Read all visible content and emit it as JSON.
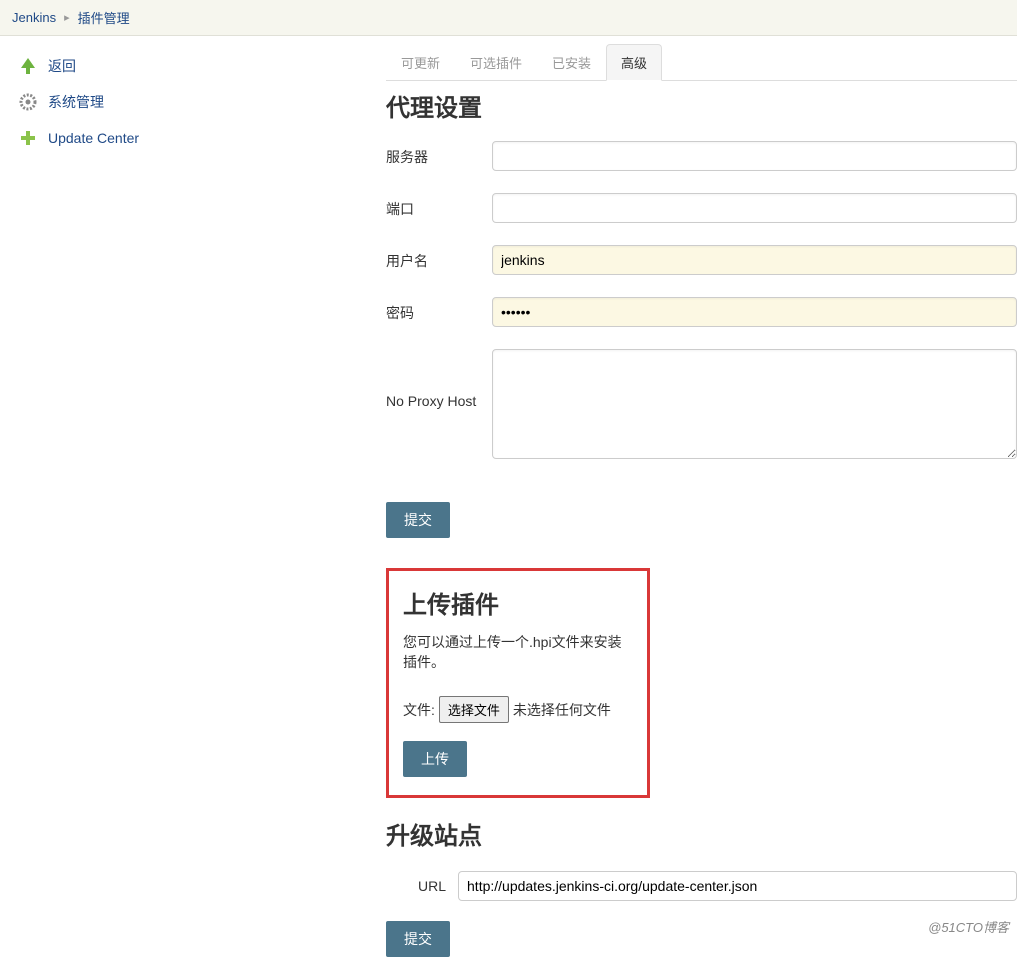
{
  "breadcrumb": {
    "root": "Jenkins",
    "page": "插件管理"
  },
  "sidebar": {
    "items": [
      {
        "label": "返回"
      },
      {
        "label": "系统管理"
      },
      {
        "label": "Update Center"
      }
    ]
  },
  "tabs": [
    {
      "label": "可更新",
      "active": false
    },
    {
      "label": "可选插件",
      "active": false
    },
    {
      "label": "已安装",
      "active": false
    },
    {
      "label": "高级",
      "active": true
    }
  ],
  "proxy": {
    "heading": "代理设置",
    "server_label": "服务器",
    "server_value": "",
    "port_label": "端口",
    "port_value": "",
    "username_label": "用户名",
    "username_value": "jenkins",
    "password_label": "密码",
    "password_value": "••••••",
    "no_proxy_label": "No Proxy Host",
    "no_proxy_value": "",
    "submit_label": "提交"
  },
  "upload": {
    "heading": "上传插件",
    "description": "您可以通过上传一个.hpi文件来安装插件。",
    "file_label": "文件:",
    "choose_button": "选择文件",
    "no_file_text": "未选择任何文件",
    "upload_button": "上传"
  },
  "update_site": {
    "heading": "升级站点",
    "url_label": "URL",
    "url_value": "http://updates.jenkins-ci.org/update-center.json",
    "submit_label": "提交"
  },
  "watermark": "@51CTO博客"
}
